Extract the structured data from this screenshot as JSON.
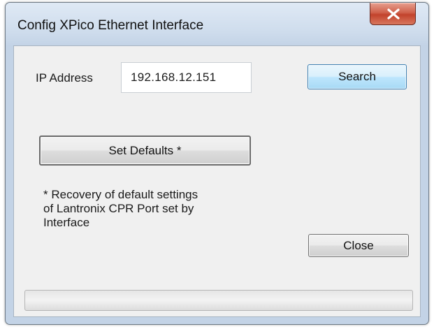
{
  "window": {
    "title": "Config XPico Ethernet Interface",
    "close_icon": "close-x-icon"
  },
  "form": {
    "ip_label": "IP Address",
    "ip_value": "192.168.12.151",
    "search_label": "Search",
    "set_defaults_label": "Set Defaults *",
    "note_lines": [
      "* Recovery of default settings",
      "of Lantronix CPR Port set by",
      "Interface"
    ],
    "close_label": "Close"
  },
  "progress": {
    "fraction": 0
  },
  "colors": {
    "close_button": "#c7452d",
    "search_button": "#bee6fd",
    "dialog_background": "#f0f0f0"
  }
}
